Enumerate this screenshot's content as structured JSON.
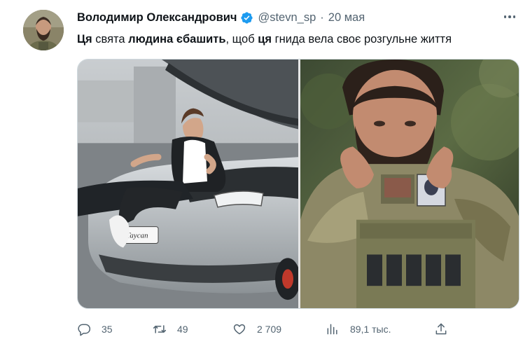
{
  "author": {
    "display_name": "Володимир Олександрович",
    "handle": "@stevn_sp",
    "separator": "·",
    "date": "20 мая",
    "verified": true,
    "avatar_icon": "avatar-photo"
  },
  "tweet": {
    "segments": [
      {
        "text": "Ця",
        "bold": true
      },
      {
        "text": " свята ",
        "bold": false
      },
      {
        "text": "людина єбашить",
        "bold": true
      },
      {
        "text": ", щоб ",
        "bold": false
      },
      {
        "text": "ця",
        "bold": true
      },
      {
        "text": " гнида вела своє розгульне життя",
        "bold": false
      }
    ]
  },
  "media": {
    "images": [
      {
        "description_icon": "photo-man-on-sports-car"
      },
      {
        "description_icon": "photo-bearded-soldier"
      }
    ]
  },
  "actions": {
    "reply_count": "35",
    "retweet_count": "49",
    "like_count": "2 709",
    "views_count": "89,1 тыс.",
    "icons": [
      "reply-icon",
      "retweet-icon",
      "like-icon",
      "views-icon",
      "share-icon"
    ]
  },
  "colors": {
    "text_primary": "#0f1419",
    "text_secondary": "#536471",
    "verified_blue": "#1d9bf0",
    "border": "#cfd9de"
  }
}
